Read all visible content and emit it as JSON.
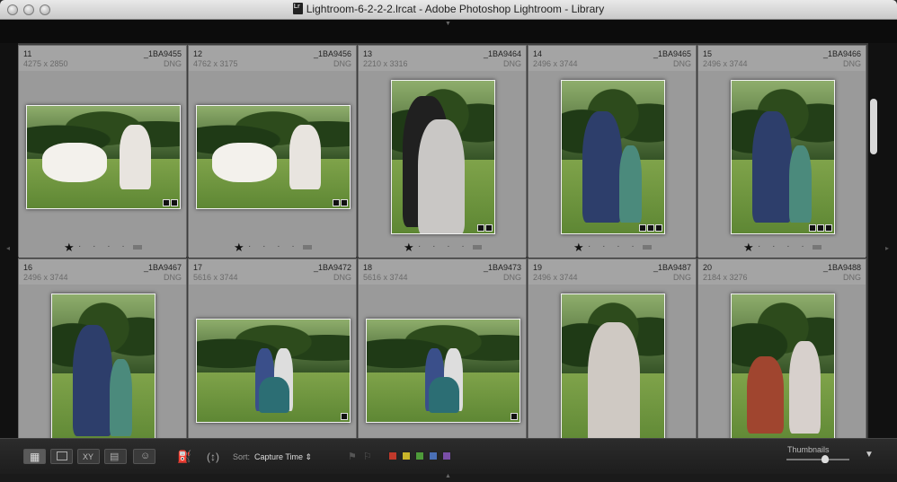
{
  "window": {
    "title": "Lightroom-6-2-2-2.lrcat - Adobe Photoshop Lightroom - Library"
  },
  "grid": {
    "cells": [
      {
        "index": "11",
        "filename": "_1BA9455",
        "dimensions": "4275 x 2850",
        "filetype": "DNG",
        "rating": 1
      },
      {
        "index": "12",
        "filename": "_1BA9456",
        "dimensions": "4762 x 3175",
        "filetype": "DNG",
        "rating": 1
      },
      {
        "index": "13",
        "filename": "_1BA9464",
        "dimensions": "2210 x 3316",
        "filetype": "DNG",
        "rating": 1
      },
      {
        "index": "14",
        "filename": "_1BA9465",
        "dimensions": "2496 x 3744",
        "filetype": "DNG",
        "rating": 1
      },
      {
        "index": "15",
        "filename": "_1BA9466",
        "dimensions": "2496 x 3744",
        "filetype": "DNG",
        "rating": 1
      },
      {
        "index": "16",
        "filename": "_1BA9467",
        "dimensions": "2496 x 3744",
        "filetype": "DNG",
        "rating": 0
      },
      {
        "index": "17",
        "filename": "_1BA9472",
        "dimensions": "5616 x 3744",
        "filetype": "DNG",
        "rating": 0
      },
      {
        "index": "18",
        "filename": "_1BA9473",
        "dimensions": "5616 x 3744",
        "filetype": "DNG",
        "rating": 0
      },
      {
        "index": "19",
        "filename": "_1BA9487",
        "dimensions": "2496 x 3744",
        "filetype": "DNG",
        "rating": 0
      },
      {
        "index": "20",
        "filename": "_1BA9488",
        "dimensions": "2184 x 3276",
        "filetype": "DNG",
        "rating": 0
      }
    ]
  },
  "toolbar": {
    "sort_label": "Sort:",
    "sort_value": "Capture Time",
    "view_buttons": [
      "grid-view",
      "loupe-view",
      "compare-view",
      "survey-view",
      "people-view"
    ],
    "compare_label": "XY",
    "color_labels": [
      "#c0392b",
      "#c9b52a",
      "#4e9a3a",
      "#4a6fb5",
      "#7a4fa8"
    ],
    "thumbnails_label": "Thumbnails",
    "thumbnail_size": 0.55
  }
}
